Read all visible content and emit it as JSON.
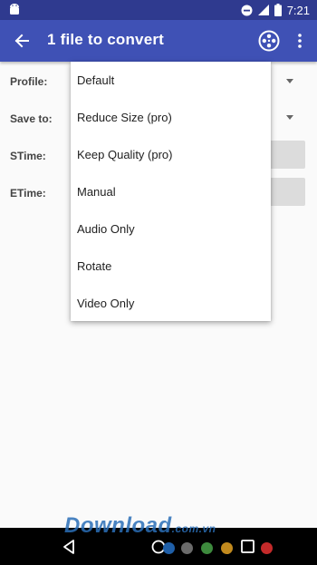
{
  "status_bar": {
    "time": "7:21",
    "icons": [
      "android-icon",
      "do-not-disturb-icon",
      "signal-icon",
      "battery-icon"
    ]
  },
  "app_bar": {
    "title": "1 file to convert",
    "icons": [
      "back-arrow-icon",
      "film-reel-icon",
      "more-vert-icon"
    ],
    "color": "#3f51b5"
  },
  "form": {
    "profile_label": "Profile:",
    "save_to_label": "Save to:",
    "stime_label": "STime:",
    "etime_label": "ETime:"
  },
  "profile_menu": {
    "items": [
      "Default",
      "Reduce Size (pro)",
      "Keep Quality (pro)",
      "Manual",
      "Audio Only",
      "Rotate",
      "Video Only"
    ]
  },
  "watermark": {
    "text": "Download",
    "sub": ".com.vn"
  },
  "nav_bar": {
    "icons": [
      "nav-back-icon",
      "nav-home-icon",
      "nav-recents-icon"
    ],
    "dot_colors": [
      "#1f5fa8",
      "#6b6b6b",
      "#3d8a3d",
      "#c28a1e",
      "#c42a2a"
    ]
  }
}
